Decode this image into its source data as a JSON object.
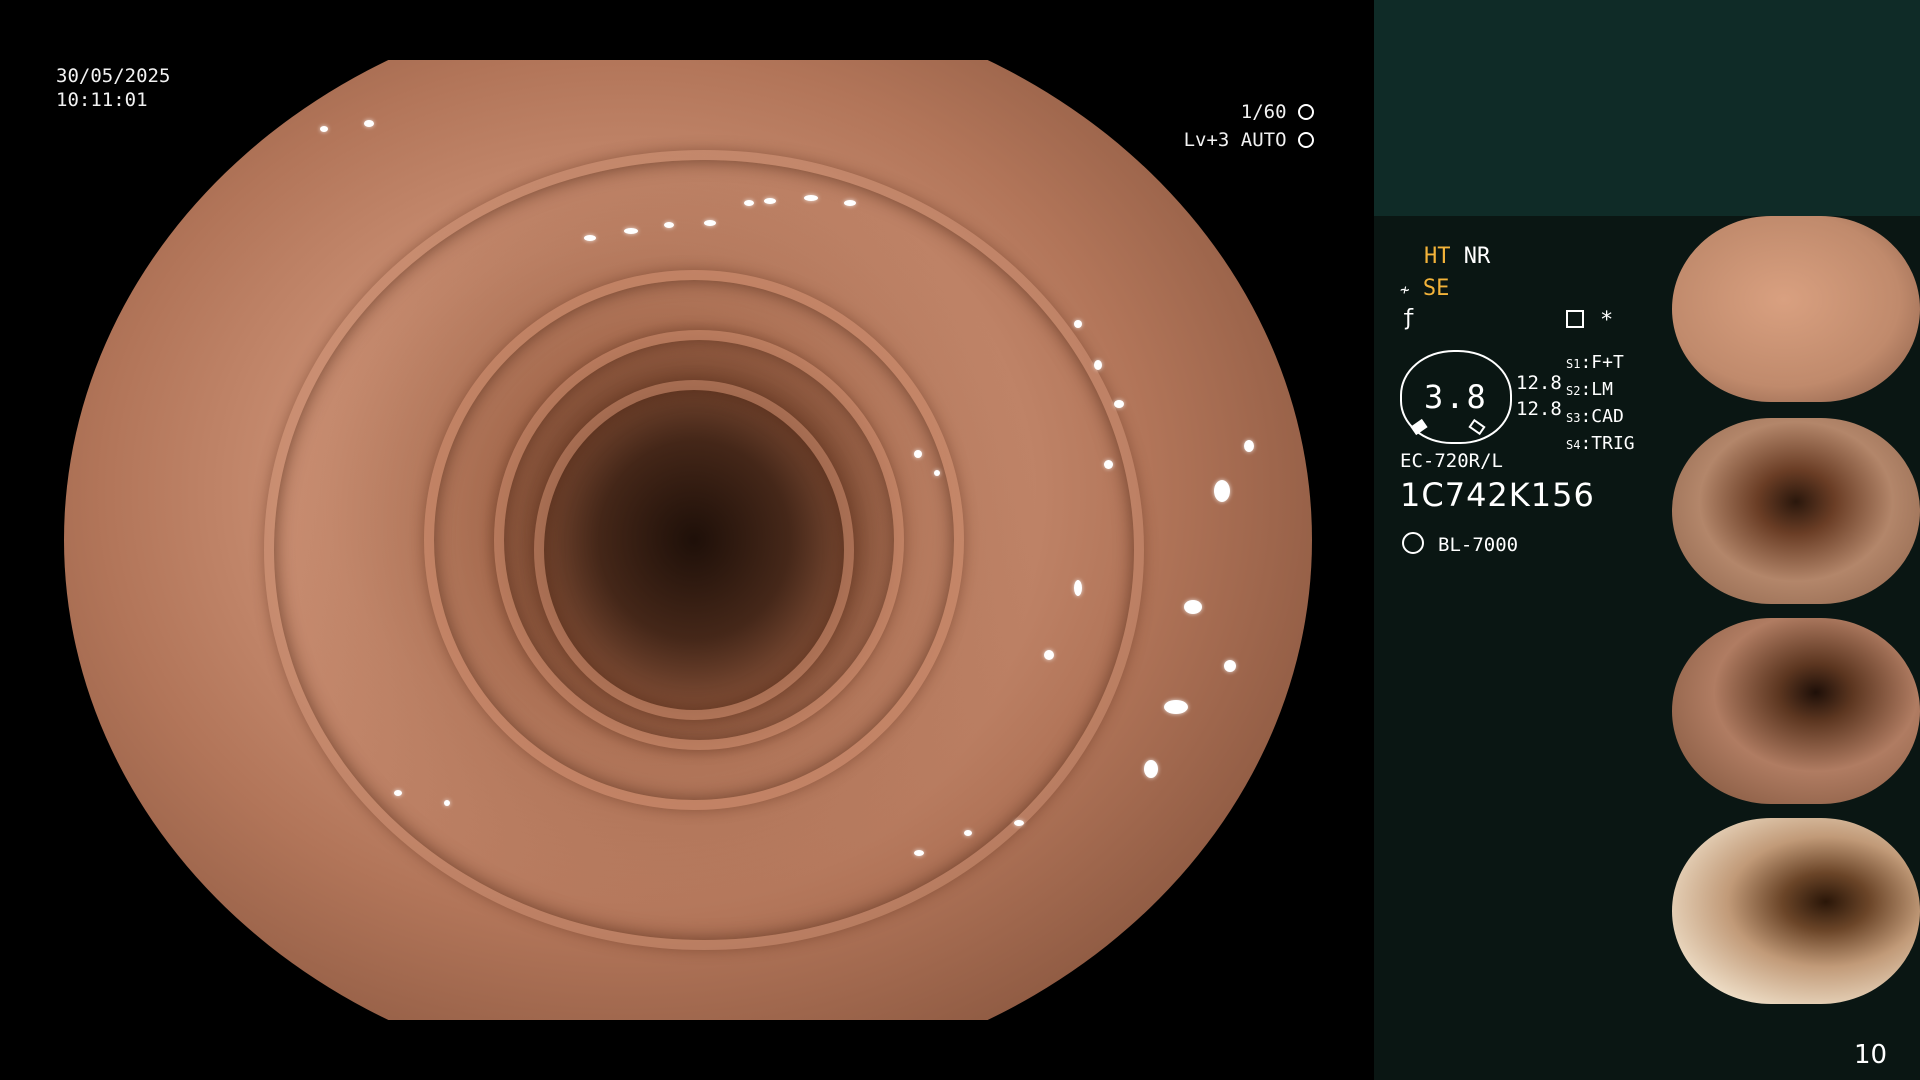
{
  "overlay": {
    "date": "30/05/2025",
    "time": "10:11:01",
    "shutter": "1/60",
    "shutter_icon": "shutter-icon",
    "level": "Lv+3",
    "iris": "AUTO",
    "iris_icon": "iris-icon"
  },
  "panel": {
    "ht": "HT",
    "nr": "NR",
    "se": "SE",
    "se_icon": "enhance-icon",
    "f_icon": "filter-icon",
    "doc_icon": "document-icon",
    "star": "*",
    "magnify": "3.8",
    "value1": "12.8",
    "value2": "12.8",
    "switches": [
      {
        "key": "S1",
        "val": "F+T"
      },
      {
        "key": "S2",
        "val": "LM"
      },
      {
        "key": "S3",
        "val": "CAD"
      },
      {
        "key": "S4",
        "val": "TRIG"
      }
    ],
    "scope_model": "EC-720R/L",
    "serial": "1C742K156",
    "light_icon": "light-source-icon",
    "light_model": "BL-7000",
    "count": "10"
  },
  "colors": {
    "accent_yellow": "#f3b33a",
    "panel_bg": "#0a1613",
    "panel_top_bg": "#0f2b27"
  }
}
